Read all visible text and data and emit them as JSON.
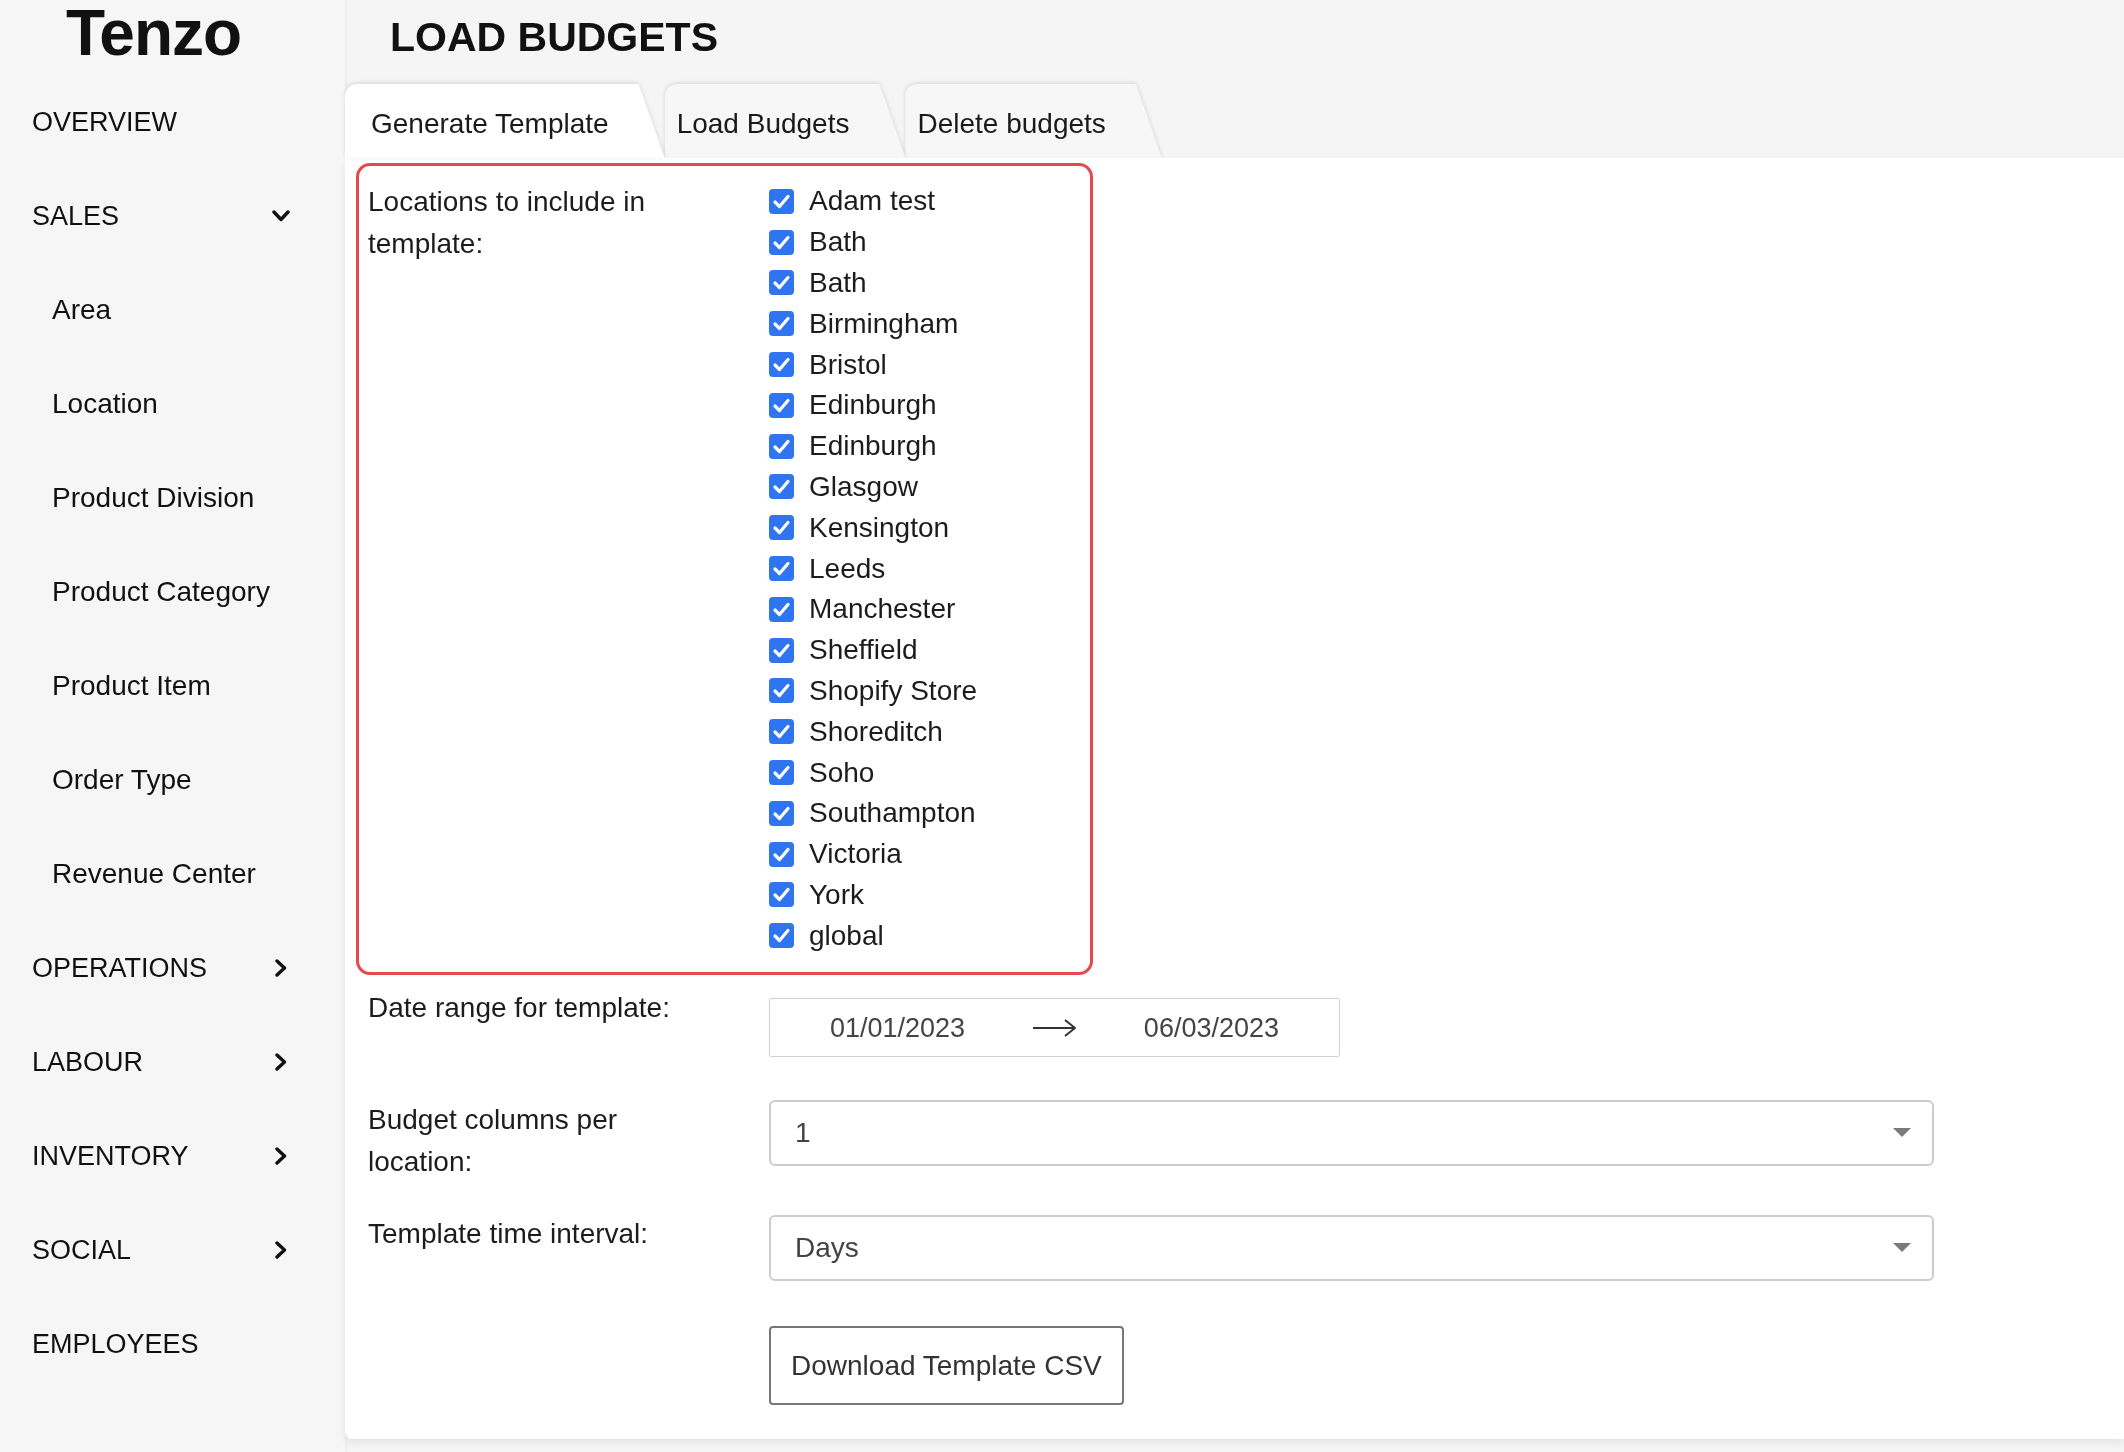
{
  "logo": {
    "text": "Tenzo"
  },
  "page_title": "LOAD BUDGETS",
  "sidebar": {
    "items": [
      {
        "label": "OVERVIEW",
        "kind": "link"
      },
      {
        "label": "SALES",
        "kind": "group",
        "expanded": true,
        "children": [
          {
            "label": "Area"
          },
          {
            "label": "Location"
          },
          {
            "label": "Product Division"
          },
          {
            "label": "Product Category"
          },
          {
            "label": "Product Item"
          },
          {
            "label": "Order Type"
          },
          {
            "label": "Revenue Center"
          }
        ]
      },
      {
        "label": "OPERATIONS",
        "kind": "group",
        "expanded": false
      },
      {
        "label": "LABOUR",
        "kind": "group",
        "expanded": false
      },
      {
        "label": "INVENTORY",
        "kind": "group",
        "expanded": false
      },
      {
        "label": "SOCIAL",
        "kind": "group",
        "expanded": false
      },
      {
        "label": "EMPLOYEES",
        "kind": "link"
      }
    ]
  },
  "tabs": [
    {
      "label": "Generate Template",
      "selected": true
    },
    {
      "label": "Load Budgets",
      "selected": false
    },
    {
      "label": "Delete budgets",
      "selected": false
    }
  ],
  "form": {
    "locations": {
      "label": "Locations to include in template:",
      "highlighted": true,
      "options": [
        {
          "label": "Adam test",
          "checked": true
        },
        {
          "label": "Bath",
          "checked": true
        },
        {
          "label": "Bath",
          "checked": true
        },
        {
          "label": "Birmingham",
          "checked": true
        },
        {
          "label": "Bristol",
          "checked": true
        },
        {
          "label": "Edinburgh",
          "checked": true
        },
        {
          "label": "Edinburgh",
          "checked": true
        },
        {
          "label": "Glasgow",
          "checked": true
        },
        {
          "label": "Kensington",
          "checked": true
        },
        {
          "label": "Leeds",
          "checked": true
        },
        {
          "label": "Manchester",
          "checked": true
        },
        {
          "label": "Sheffield",
          "checked": true
        },
        {
          "label": "Shopify Store",
          "checked": true
        },
        {
          "label": "Shoreditch",
          "checked": true
        },
        {
          "label": "Soho",
          "checked": true
        },
        {
          "label": "Southampton",
          "checked": true
        },
        {
          "label": "Victoria",
          "checked": true
        },
        {
          "label": "York",
          "checked": true
        },
        {
          "label": "global",
          "checked": true
        }
      ]
    },
    "date_range": {
      "label": "Date range for template:",
      "start": "01/01/2023",
      "end": "06/03/2023"
    },
    "budget_columns": {
      "label": "Budget columns per location:",
      "value": "1"
    },
    "time_interval": {
      "label": "Template time interval:",
      "value": "Days"
    },
    "download_button": {
      "label": "Download Template CSV"
    }
  }
}
